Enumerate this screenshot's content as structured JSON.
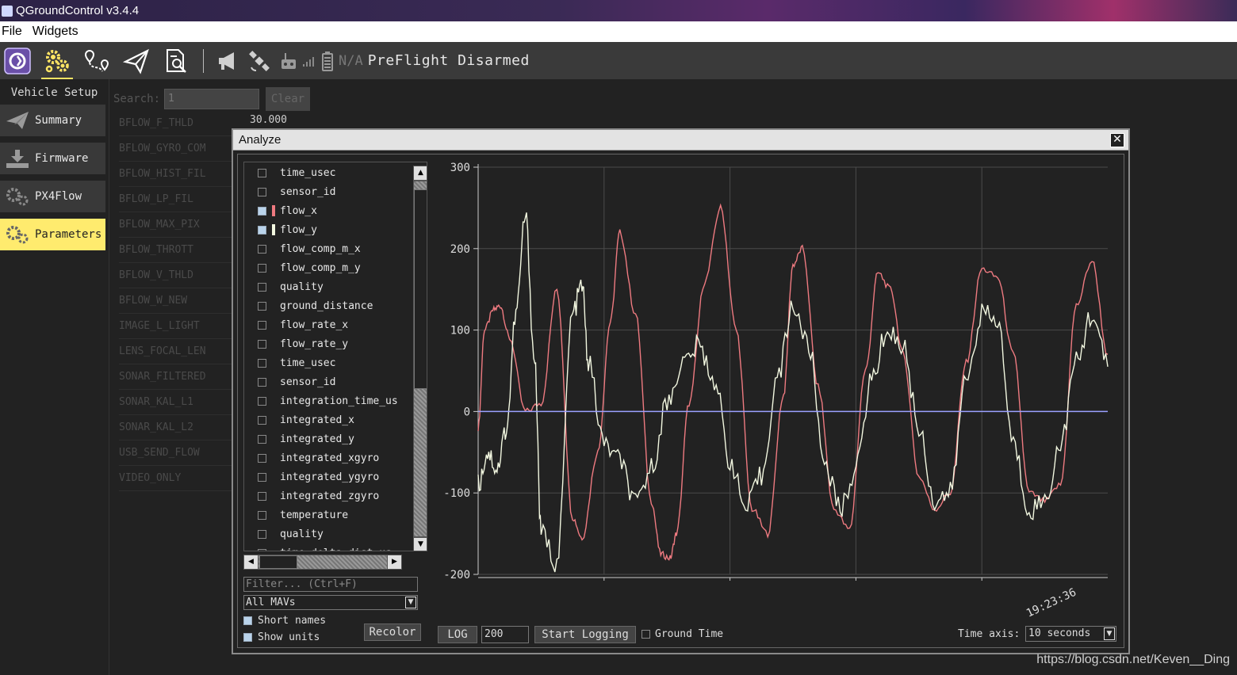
{
  "window": {
    "title": "QGroundControl v3.4.4"
  },
  "menu": [
    "File",
    "Widgets"
  ],
  "toolbar": {
    "buttons": [
      {
        "name": "qgc-logo-icon"
      },
      {
        "name": "vehicle-setup-gear-icon",
        "active": true
      },
      {
        "name": "plan-view-icon"
      },
      {
        "name": "fly-view-icon"
      },
      {
        "name": "analyze-view-icon"
      }
    ],
    "status_icons": [
      "megaphone-icon",
      "gps-icon",
      "rc-icon",
      "signal-icon",
      "battery-icon"
    ],
    "battery_text": "N/A",
    "status_text": "PreFlight Disarmed"
  },
  "leftnav": {
    "title": "Vehicle Setup",
    "items": [
      {
        "label": "Summary",
        "icon": "plane-icon"
      },
      {
        "label": "Firmware",
        "icon": "download-icon"
      },
      {
        "label": "PX4Flow",
        "icon": "gears-icon"
      },
      {
        "label": "Parameters",
        "icon": "gears-icon",
        "active": true
      }
    ]
  },
  "params": {
    "search_label": "Search:",
    "search_value": "1",
    "clear_label": "Clear",
    "first_value": "30.000",
    "names": [
      "BFLOW_F_THLD",
      "BFLOW_GYRO_COM",
      "BFLOW_HIST_FIL",
      "BFLOW_LP_FIL",
      "BFLOW_MAX_PIX",
      "BFLOW_THROTT",
      "BFLOW_V_THLD",
      "BFLOW_W_NEW",
      "IMAGE_L_LIGHT",
      "LENS_FOCAL_LEN",
      "SONAR_FILTERED",
      "SONAR_KAL_L1",
      "SONAR_KAL_L2",
      "USB_SEND_FLOW",
      "VIDEO_ONLY"
    ]
  },
  "analyze": {
    "title": "Analyze",
    "close": "✕",
    "curves": [
      {
        "label": "time_usec",
        "checked": false
      },
      {
        "label": "sensor_id",
        "checked": false
      },
      {
        "label": "flow_x",
        "checked": true,
        "color": "#ee7a80"
      },
      {
        "label": "flow_y",
        "checked": true,
        "color": "#f2f7e0"
      },
      {
        "label": "flow_comp_m_x",
        "checked": false
      },
      {
        "label": "flow_comp_m_y",
        "checked": false
      },
      {
        "label": "quality",
        "checked": false
      },
      {
        "label": "ground_distance",
        "checked": false
      },
      {
        "label": "flow_rate_x",
        "checked": false
      },
      {
        "label": "flow_rate_y",
        "checked": false
      },
      {
        "label": "time_usec",
        "checked": false
      },
      {
        "label": "sensor_id",
        "checked": false
      },
      {
        "label": "integration_time_us",
        "checked": false
      },
      {
        "label": "integrated_x",
        "checked": false
      },
      {
        "label": "integrated_y",
        "checked": false
      },
      {
        "label": "integrated_xgyro",
        "checked": false
      },
      {
        "label": "integrated_ygyro",
        "checked": false
      },
      {
        "label": "integrated_zgyro",
        "checked": false
      },
      {
        "label": "temperature",
        "checked": false
      },
      {
        "label": "quality",
        "checked": false
      },
      {
        "label": "time_delta_dist_us",
        "checked": false
      }
    ],
    "filter_placeholder": "Filter... (Ctrl+F)",
    "mav_select": "All MAVs",
    "short_names": "Short names",
    "show_units": "Show units",
    "recolor": "Recolor",
    "log_button": "LOG",
    "log_value": "200",
    "start_logging": "Start Logging",
    "ground_time": "Ground Time",
    "time_axis_label": "Time axis:",
    "time_axis_value": "10 seconds"
  },
  "chart_data": {
    "type": "line",
    "ylim": [
      -200,
      300
    ],
    "yticks": [
      300,
      200,
      100,
      0,
      -100,
      -200
    ],
    "x_tick_label": "19:23:36",
    "grid": true,
    "series": [
      {
        "name": "flow_x",
        "color": "#ee7a80",
        "x": [
          0,
          2,
          5,
          7,
          10,
          15,
          20,
          25,
          30,
          33,
          38,
          42,
          45,
          50,
          55,
          58,
          61,
          63,
          67,
          72,
          77,
          82,
          87,
          92,
          97,
          100,
          103,
          108,
          113,
          118,
          123,
          127,
          131,
          135,
          140,
          145,
          150,
          155,
          160,
          165,
          170,
          175,
          180,
          185,
          190,
          195,
          200
        ],
        "y": [
          -20,
          100,
          125,
          130,
          90,
          0,
          10,
          150,
          -130,
          -155,
          -50,
          110,
          220,
          120,
          -110,
          -175,
          -180,
          -150,
          10,
          160,
          250,
          100,
          -120,
          -150,
          20,
          180,
          200,
          30,
          -120,
          -145,
          50,
          170,
          150,
          70,
          -80,
          -120,
          -100,
          60,
          175,
          165,
          70,
          -100,
          -110,
          -90,
          130,
          185,
          70
        ]
      },
      {
        "name": "flow_y",
        "color": "#f2f7e0",
        "x": [
          0,
          3,
          6,
          9,
          12,
          15,
          18,
          20,
          25,
          30,
          33,
          35,
          40,
          45,
          50,
          55,
          60,
          65,
          70,
          75,
          80,
          85,
          90,
          95,
          100,
          105,
          110,
          115,
          120,
          125,
          130,
          135,
          140,
          145,
          150,
          155,
          160,
          165,
          170,
          175,
          180,
          185,
          190,
          195,
          200
        ],
        "y": [
          -90,
          -50,
          -70,
          -20,
          120,
          240,
          60,
          -150,
          -185,
          120,
          155,
          60,
          -40,
          -60,
          -115,
          -70,
          10,
          60,
          80,
          40,
          -60,
          -120,
          -80,
          40,
          130,
          80,
          -60,
          -120,
          -70,
          40,
          100,
          80,
          -20,
          -110,
          -100,
          40,
          120,
          110,
          -40,
          -120,
          -110,
          -40,
          60,
          120,
          55
        ]
      },
      {
        "name": "zero",
        "color": "#9aa0ff",
        "x": [
          0,
          200
        ],
        "y": [
          0,
          0
        ]
      }
    ]
  }
}
